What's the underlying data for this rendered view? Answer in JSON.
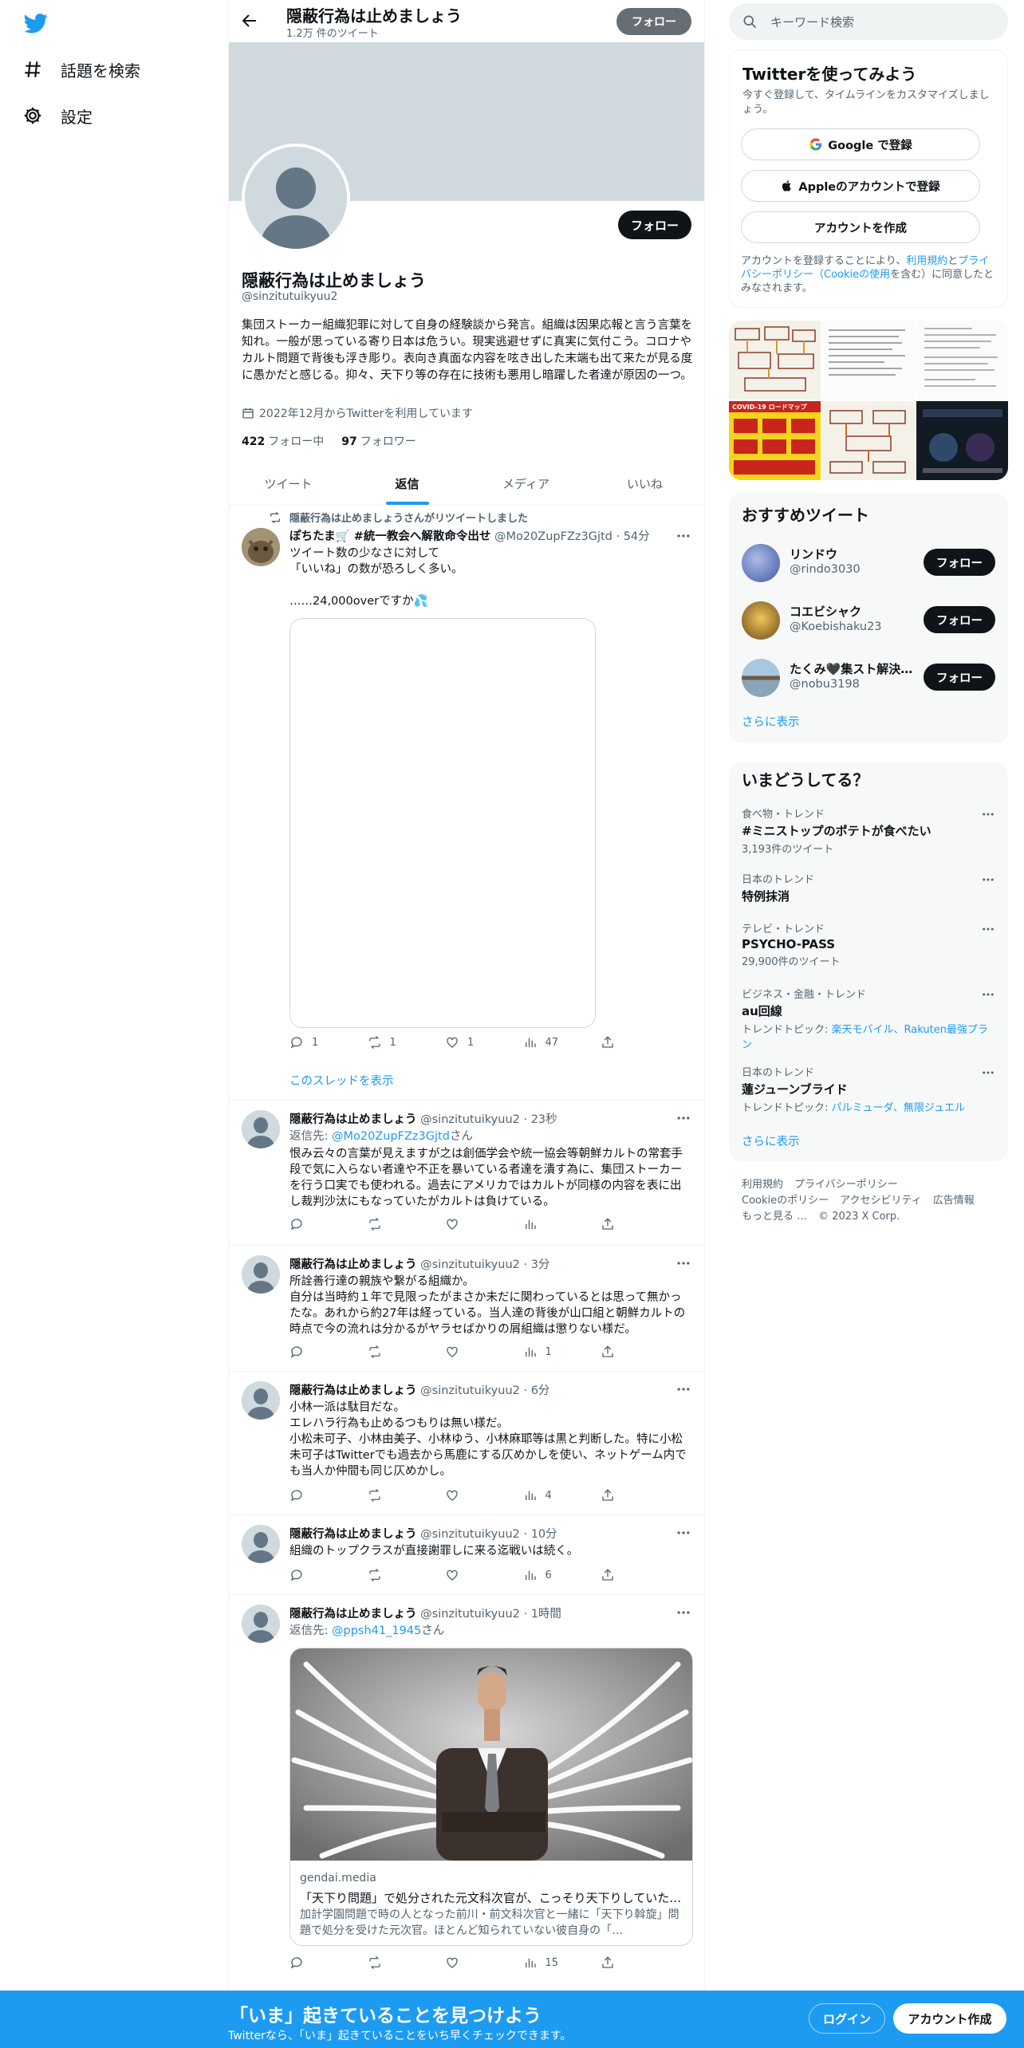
{
  "nav": {
    "explore": "話題を検索",
    "settings": "設定"
  },
  "header": {
    "name": "隠蔽行為は止めましょう",
    "tweet_count": "1.2万 件のツイート",
    "follow": "フォロー"
  },
  "profile": {
    "follow": "フォロー",
    "name": "隠蔽行為は止めましょう",
    "handle": "@sinzitutuikyuu2",
    "bio": "集団ストーカー組織犯罪に対して自身の経験談から発言。組織は因果応報と言う言葉を知れ。一般が思っている寄り日本は危うい。現実逃避せずに真実に気付こう。コロナやカルト問題で背後も浮き彫り。表向き真面な内容を呟き出した末端も出て来たが見る度に愚かだと感じる。抑々、天下り等の存在に技術も悪用し暗躍した者達が原因の一つ。",
    "joined": "2022年12月からTwitterを利用しています",
    "following_count": "422",
    "following_label": "フォロー中",
    "followers_count": "97",
    "followers_label": "フォロワー"
  },
  "tabs": [
    "ツイート",
    "返信",
    "メディア",
    "いいね"
  ],
  "tweets": [
    {
      "retweet_label": "隠蔽行為は止めましょうさんがリツイートしました",
      "name": "ぽちたま🛒 #統一教会へ解散命令出せ",
      "handle": "@Mo20ZupFZz3Gjtd",
      "time": "· 54分",
      "text_lines": [
        "ツイート数の少なさに対して",
        "「いいね」の数が恐ろしく多い。",
        "",
        "……24,000overですか💦"
      ],
      "reply": "1",
      "retweet": "1",
      "like": "1",
      "views": "47",
      "thread": "このスレッドを表示"
    },
    {
      "name": "隠蔽行為は止めましょう",
      "handle": "@sinzitutuikyuu2",
      "time": "· 23秒",
      "reply_prefix": "返信先: ",
      "reply_to": "@Mo20ZupFZz3Gjtd",
      "reply_suffix": "さん",
      "text": "恨み云々の言葉が見えますが之は創価学会や統一協会等朝鮮カルトの常套手段で気に入らない者達や不正を暴いている者達を潰す為に、集団ストーカーを行う口実でも使われる。過去にアメリカではカルトが同様の内容を表に出し裁判沙汰にもなっていたがカルトは負けている。",
      "reply": "",
      "retweet": "",
      "like": "",
      "views": ""
    },
    {
      "name": "隠蔽行為は止めましょう",
      "handle": "@sinzitutuikyuu2",
      "time": "· 3分",
      "text": "所詮善行達の親族や繋がる組織か。\n自分は当時約１年で見限ったがまさか未だに関わっているとは思って無かったな。あれから約27年は経っている。当人達の背後が山口組と朝鮮カルトの時点で今の流れは分かるがヤラセばかりの屑組織は懲りない様だ。",
      "reply": "",
      "retweet": "",
      "like": "",
      "views": "1"
    },
    {
      "name": "隠蔽行為は止めましょう",
      "handle": "@sinzitutuikyuu2",
      "time": "· 6分",
      "text": "小林一派は駄目だな。\nエレハラ行為も止めるつもりは無い様だ。\n小松未可子、小林由美子、小林ゆう、小林麻耶等は黒と判断した。特に小松未可子はTwitterでも過去から馬鹿にする仄めかしを使い、ネットゲーム内でも当人か仲間も同じ仄めかし。",
      "reply": "",
      "retweet": "",
      "like": "",
      "views": "4"
    },
    {
      "name": "隠蔽行為は止めましょう",
      "handle": "@sinzitutuikyuu2",
      "time": "· 10分",
      "text": "組織のトップクラスが直接謝罪しに来る迄戦いは続く。",
      "reply": "",
      "retweet": "",
      "like": "",
      "views": "6"
    },
    {
      "name": "隠蔽行為は止めましょう",
      "handle": "@sinzitutuikyuu2",
      "time": "· 1時間",
      "reply_prefix": "返信先: ",
      "reply_to": "@ppsh41_1945",
      "reply_suffix": "さん",
      "card_domain": "gendai.media",
      "card_title": "「天下り問題」で処分された元文科次官が、こっそり天下りしていた…",
      "card_desc": "加計学園問題で時の人となった前川・前文科次官と一緒に「天下り斡旋」問題で処分を受けた元次官。ほとんど知られていない彼自身の「…",
      "reply": "",
      "retweet": "",
      "like": "",
      "views": "15"
    }
  ],
  "right": {
    "search_placeholder": "キーワード検索",
    "signup_title": "Twitterを使ってみよう",
    "signup_sub": "今すぐ登録して、タイムラインをカスタマイズしましょう。",
    "google": "Google で登録",
    "apple": "Appleのアカウントで登録",
    "create": "アカウントを作成",
    "terms_1": "アカウントを登録することにより、",
    "terms_link1": "利用規約",
    "terms_2": "と",
    "terms_link2": "プライバシーポリシー（Cookieの使用",
    "terms_3": "を含む）に同意したとみなされます。",
    "rec_title": "おすすめツイート",
    "recs": [
      {
        "name": "リンドウ",
        "handle": "@rindo3030",
        "btn": "フォロー"
      },
      {
        "name": "コエビシャク",
        "handle": "@Koebishaku23",
        "btn": "フォロー"
      },
      {
        "name": "たくみ🖤集スト解決…",
        "handle": "@nobu3198",
        "btn": "フォロー"
      }
    ],
    "show_more": "さらに表示",
    "trends_title": "いまどうしてる？",
    "trends": [
      {
        "cat": "食べ物・トレンド",
        "title": "#ミニストップのポテトが食べたい",
        "count": "3,193件のツイート"
      },
      {
        "cat": "日本のトレンド",
        "title": "特例抹消",
        "count": ""
      },
      {
        "cat": "テレビ・トレンド",
        "title": "PSYCHO-PASS",
        "count": "29,900件のツイート"
      },
      {
        "cat": "ビジネス・金融・トレンド",
        "title": "au回線",
        "topic_label": "トレンドトピック: ",
        "topic": "楽天モバイル、Rakuten最強プラン"
      },
      {
        "cat": "日本のトレンド",
        "title": "蓮ジューンブライド",
        "topic_label": "トレンドトピック: ",
        "topic": "パルミューダ、無限ジュエル"
      }
    ],
    "trends_more": "さらに表示",
    "footer": [
      "利用規約",
      "プライバシーポリシー",
      "Cookieのポリシー",
      "アクセシビリティ",
      "広告情報",
      "もっと見る …",
      "© 2023 X Corp."
    ],
    "photo_labels": {
      "covid": "COVID-19 ロードマップ"
    }
  },
  "bottom": {
    "title": "「いま」起きていることを見つけよう",
    "sub": "Twitterなら、「いま」起きていることをいち早くチェックできます。",
    "login": "ログイン",
    "signup": "アカウント作成"
  },
  "colors": {
    "accent": "#1d9bf0",
    "text": "#0f1419",
    "muted": "#536471",
    "border": "#eff3f4"
  }
}
